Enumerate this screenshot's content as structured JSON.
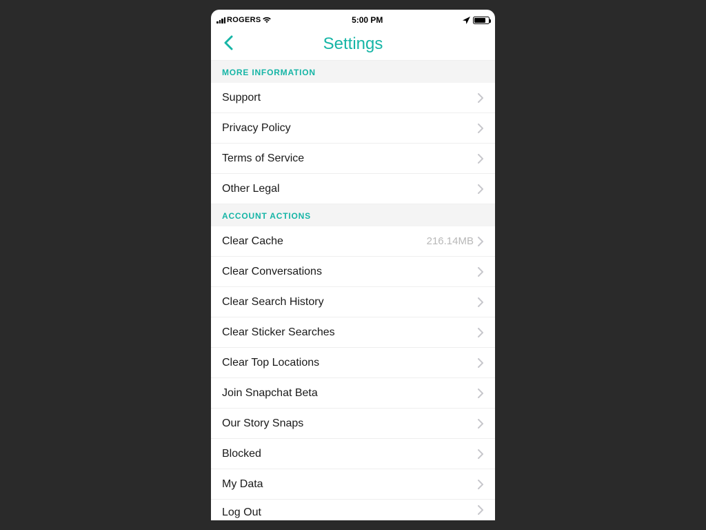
{
  "statusBar": {
    "carrier": "ROGERS",
    "time": "5:00 PM"
  },
  "header": {
    "title": "Settings"
  },
  "sections": {
    "moreInfo": {
      "header": "MORE INFORMATION",
      "items": {
        "support": "Support",
        "privacy": "Privacy Policy",
        "tos": "Terms of Service",
        "otherLegal": "Other Legal"
      }
    },
    "accountActions": {
      "header": "ACCOUNT ACTIONS",
      "items": {
        "clearCache": {
          "label": "Clear Cache",
          "value": "216.14MB"
        },
        "clearConversations": "Clear Conversations",
        "clearSearchHistory": "Clear Search History",
        "clearStickerSearches": "Clear Sticker Searches",
        "clearTopLocations": "Clear Top Locations",
        "joinBeta": "Join Snapchat Beta",
        "ourStorySnaps": "Our Story Snaps",
        "blocked": "Blocked",
        "myData": "My Data",
        "logOut": "Log Out"
      }
    }
  }
}
